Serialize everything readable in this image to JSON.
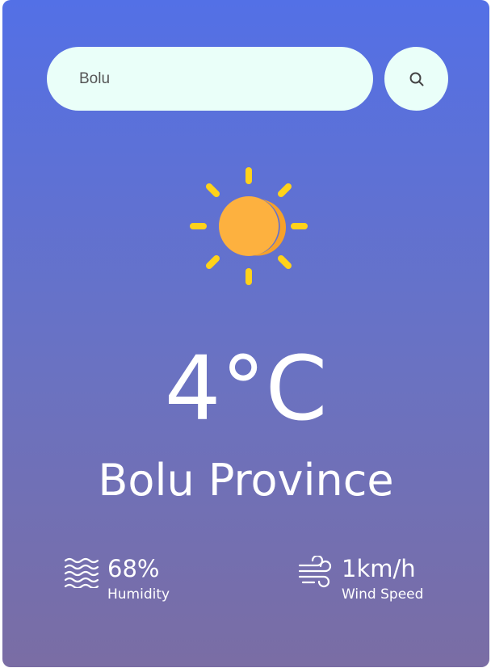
{
  "search": {
    "value": "Bolu",
    "placeholder": "",
    "button_icon": "search-icon"
  },
  "weather": {
    "icon": "sun-icon",
    "temperature": "4°C",
    "city": "Bolu Province"
  },
  "details": {
    "humidity": {
      "icon": "humidity-icon",
      "value": "68%",
      "label": "Humidity"
    },
    "wind": {
      "icon": "wind-icon",
      "value": "1km/h",
      "label": "Wind Speed"
    }
  },
  "colors": {
    "gradient_top": "#5370e6",
    "gradient_bottom": "#7a6da4",
    "input_bg": "#eafff9",
    "sun_rays": "#ffd21a",
    "sun_core": "#fdb13f",
    "text": "#ffffff"
  }
}
